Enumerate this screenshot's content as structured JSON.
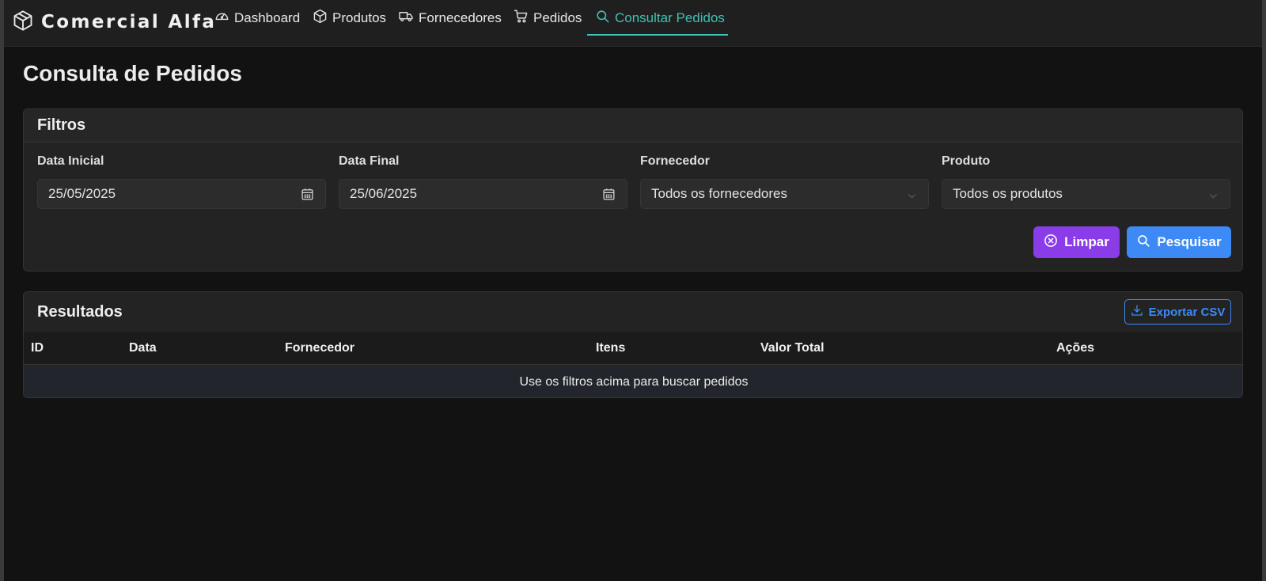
{
  "app": {
    "brand": "Comercial Alfa"
  },
  "nav": {
    "items": [
      {
        "label": "Dashboard",
        "icon": "gauge-icon"
      },
      {
        "label": "Produtos",
        "icon": "box-icon"
      },
      {
        "label": "Fornecedores",
        "icon": "truck-icon"
      },
      {
        "label": "Pedidos",
        "icon": "cart-icon"
      },
      {
        "label": "Consultar Pedidos",
        "icon": "search-icon",
        "active": true
      }
    ]
  },
  "page": {
    "title": "Consulta de Pedidos"
  },
  "filters": {
    "header": "Filtros",
    "data_inicial": {
      "label": "Data Inicial",
      "value": "25/05/2025"
    },
    "data_final": {
      "label": "Data Final",
      "value": "25/06/2025"
    },
    "fornecedor": {
      "label": "Fornecedor",
      "value": "Todos os fornecedores"
    },
    "produto": {
      "label": "Produto",
      "value": "Todos os produtos"
    },
    "clear_label": "Limpar",
    "search_label": "Pesquisar"
  },
  "results": {
    "header": "Resultados",
    "export_label": "Exportar CSV",
    "columns": [
      "ID",
      "Data",
      "Fornecedor",
      "Itens",
      "Valor Total",
      "Ações"
    ],
    "empty_message": "Use os filtros acima para buscar pedidos"
  },
  "colors": {
    "accent": "#3fc2b3",
    "primary": "#3d8af6",
    "clear": "#8a3ce8",
    "background": "#121212"
  }
}
